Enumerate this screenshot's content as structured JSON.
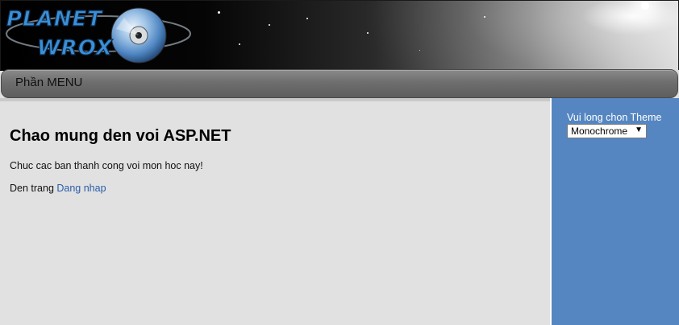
{
  "header": {
    "logo_text": "PLANET WROX"
  },
  "menu": {
    "label": "Phần MENU"
  },
  "main": {
    "title": "Chao mung den voi ASP.NET",
    "intro": "Chuc cac ban thanh cong voi mon hoc nay!",
    "login_prefix": "Den trang ",
    "login_link": "Dang nhap"
  },
  "sidebar": {
    "theme_label": "Vui long chon Theme",
    "theme_selected": "Monochrome"
  },
  "colors": {
    "sidebar_bg": "#5586c1",
    "content_bg": "#e1e1e1",
    "link": "#2b5ea8",
    "logo_blue": "#3a8fd6"
  }
}
